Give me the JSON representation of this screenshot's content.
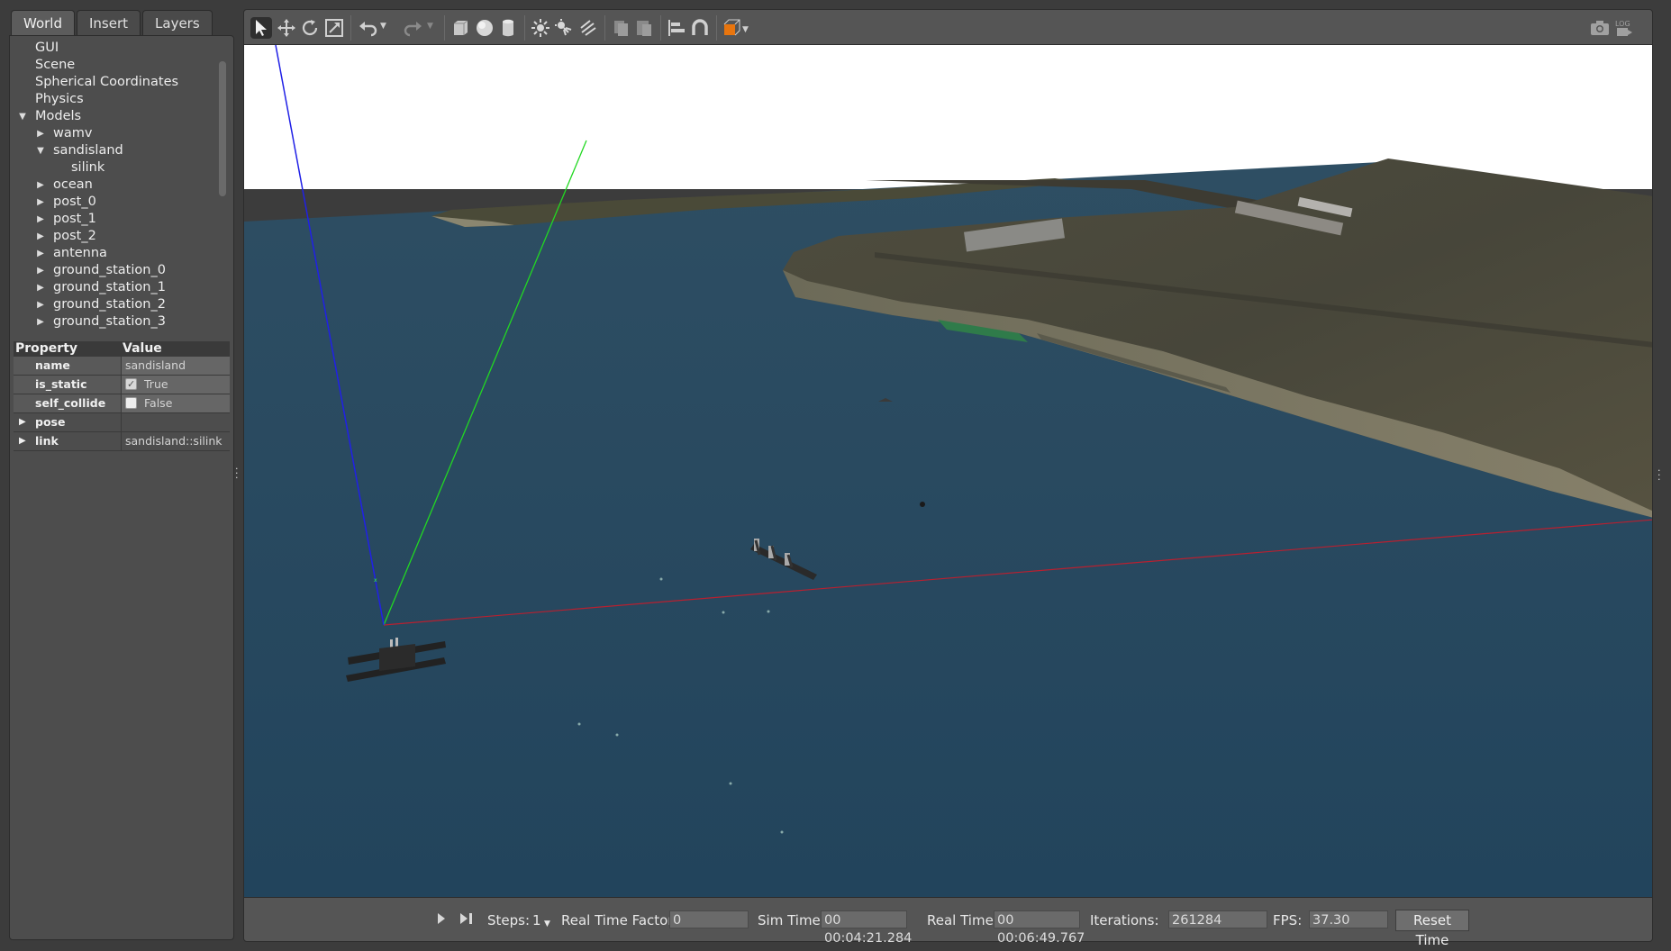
{
  "tabs": [
    "World",
    "Insert",
    "Layers"
  ],
  "tree": [
    {
      "label": "GUI",
      "level": 0,
      "arrow": ""
    },
    {
      "label": "Scene",
      "level": 0,
      "arrow": ""
    },
    {
      "label": "Spherical Coordinates",
      "level": 0,
      "arrow": ""
    },
    {
      "label": "Physics",
      "level": 0,
      "arrow": ""
    },
    {
      "label": "Models",
      "level": 0,
      "arrow": "▼"
    },
    {
      "label": "wamv",
      "level": 1,
      "arrow": "▶"
    },
    {
      "label": "sandisland",
      "level": 1,
      "arrow": "▼"
    },
    {
      "label": "silink",
      "level": 2,
      "arrow": ""
    },
    {
      "label": "ocean",
      "level": 1,
      "arrow": "▶"
    },
    {
      "label": "post_0",
      "level": 1,
      "arrow": "▶"
    },
    {
      "label": "post_1",
      "level": 1,
      "arrow": "▶"
    },
    {
      "label": "post_2",
      "level": 1,
      "arrow": "▶"
    },
    {
      "label": "antenna",
      "level": 1,
      "arrow": "▶"
    },
    {
      "label": "ground_station_0",
      "level": 1,
      "arrow": "▶"
    },
    {
      "label": "ground_station_1",
      "level": 1,
      "arrow": "▶"
    },
    {
      "label": "ground_station_2",
      "level": 1,
      "arrow": "▶"
    },
    {
      "label": "ground_station_3",
      "level": 1,
      "arrow": "▶"
    }
  ],
  "props": {
    "header": {
      "property": "Property",
      "value": "Value"
    },
    "name": {
      "label": "name",
      "value": "sandisland"
    },
    "is_static": {
      "label": "is_static",
      "value": "True",
      "checked": true
    },
    "self_collide": {
      "label": "self_collide",
      "value": "False",
      "checked": false
    },
    "pose": {
      "label": "pose",
      "value": ""
    },
    "link": {
      "label": "link",
      "value": "sandisland::silink"
    }
  },
  "toolbar": {
    "icons": [
      "select-arrow-icon",
      "translate-icon",
      "rotate-icon",
      "scale-icon",
      "undo-icon",
      "redo-icon",
      "box-icon",
      "sphere-icon",
      "cylinder-icon",
      "point-light-icon",
      "spot-light-icon",
      "directional-light-icon",
      "copy-icon",
      "paste-icon",
      "align-icon",
      "snap-magnet-icon",
      "view-angle-icon",
      "screenshot-icon",
      "log-icon"
    ],
    "log_label": "LOG"
  },
  "bottom": {
    "steps_label": "Steps:",
    "steps_value": "1",
    "rtf_label": "Real Time Factor:",
    "rtf_value": "0",
    "sim_time_label": "Sim Time:",
    "sim_time_value": "00 00:04:21.284",
    "real_time_label": "Real Time:",
    "real_time_value": "00 00:06:49.767",
    "iterations_label": "Iterations:",
    "iterations_value": "261284",
    "fps_label": "FPS:",
    "fps_value": "37.30",
    "reset_label": "Reset Time"
  },
  "colors": {
    "sky": "#ffffff",
    "water": "#25475f",
    "land": "#4a4a3c",
    "beach": "#7a7560",
    "axis_x": "#c0202a",
    "axis_y": "#22dd22",
    "axis_z": "#1a1aee",
    "panel_bg": "#4d4d4d"
  }
}
